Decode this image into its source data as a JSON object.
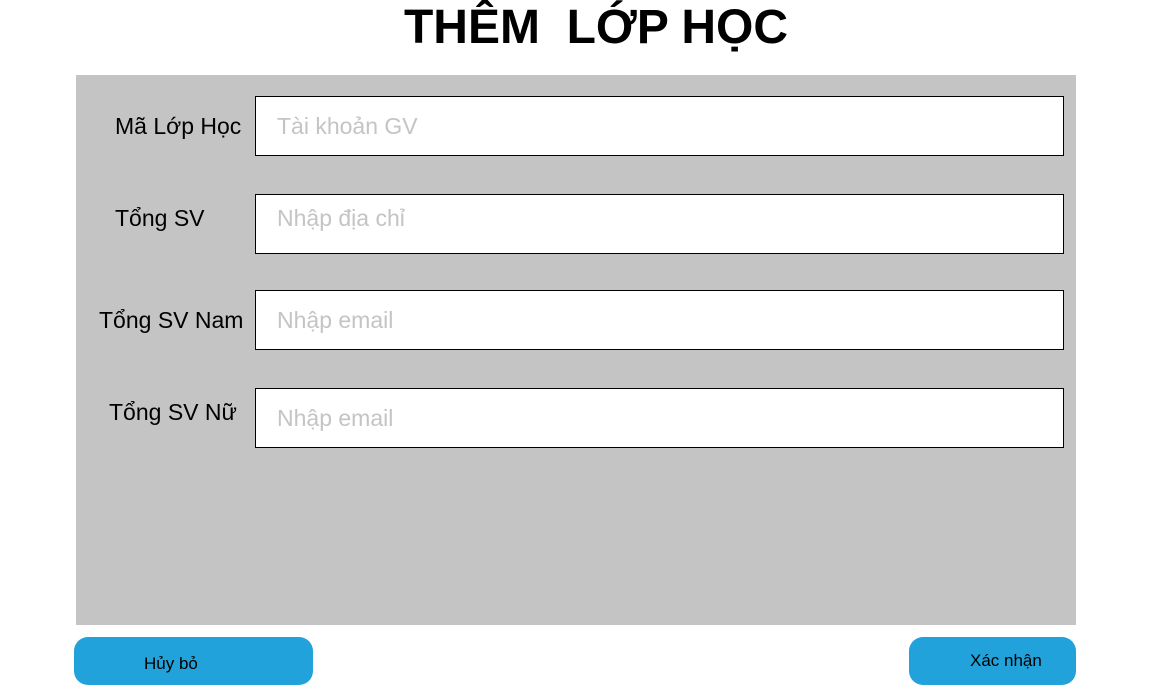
{
  "page": {
    "title": "THÊM  LỚP HỌC"
  },
  "form": {
    "fields": [
      {
        "label": "Mã Lớp Học",
        "placeholder": "Tài khoản GV",
        "value": ""
      },
      {
        "label": "Tổng SV",
        "placeholder": "Nhập địa chỉ",
        "value": ""
      },
      {
        "label": "Tổng SV Nam",
        "placeholder": "Nhập email",
        "value": ""
      },
      {
        "label": "Tổng SV Nữ",
        "placeholder": "Nhập email",
        "value": ""
      }
    ]
  },
  "buttons": {
    "cancel_label": "Hủy bỏ",
    "confirm_label": "Xác nhận"
  },
  "colors": {
    "panel_background": "#c4c4c4",
    "button_background": "#22a2da",
    "placeholder_text": "#c4c4c4"
  }
}
